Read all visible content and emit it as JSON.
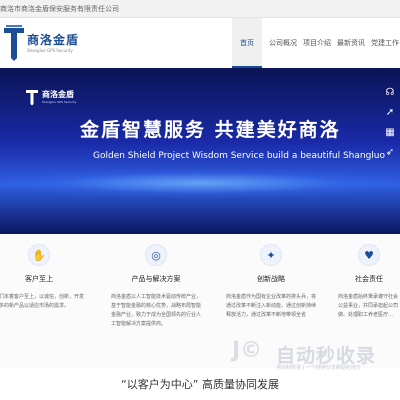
{
  "topbar": {
    "company_full": "商洛市商洛金盾保安服务有限责任公司"
  },
  "header": {
    "logo_name": "商洛金盾",
    "logo_sub": "Shangluo GPS Security"
  },
  "nav": [
    {
      "label": "首页",
      "active": true
    },
    {
      "label": "公司概况",
      "active": false
    },
    {
      "label": "项目介绍",
      "active": false
    },
    {
      "label": "最新资讯",
      "active": false
    },
    {
      "label": "党建工作",
      "active": false
    }
  ],
  "banner": {
    "logo_name": "商洛金盾",
    "logo_sub": "Shangluo GPS Security",
    "title": "金盾智慧服务   共建美好商洛",
    "subtitle": "Golden Shield Project Wisdom Service   build a beautiful Shangluo"
  },
  "side_tools": [
    {
      "icon": "headset-icon",
      "glyph": "☊"
    },
    {
      "icon": "share-icon",
      "glyph": "➚"
    },
    {
      "icon": "qrcode-icon",
      "glyph": "▦"
    },
    {
      "icon": "rocket-icon",
      "glyph": "➶"
    }
  ],
  "features": [
    {
      "title": "客户至上",
      "desc": "我们本着客户至上，以诚信，创新，开发更多的新产品以适应市场的需求。",
      "icon": "handshake-icon",
      "glyph": "✋"
    },
    {
      "title": "产品与解决方案",
      "desc": "商洛金盾以人工智能技术驱动传统产业，基于智能金融的核心优势，战略布局智能金融产业，致力于成为全国领先的行业人工智能解决方案提供商。",
      "icon": "product-icon",
      "glyph": "◎"
    },
    {
      "title": "创新战略",
      "desc": "商洛金盾作为国有企业改革的排头兵，将通过改革不断注入新动能，通过创新持续释放活力，通过改革不断地带领全省",
      "icon": "bulb-icon",
      "glyph": "✦"
    },
    {
      "title": "社会责任",
      "desc": "商洛金盾始终秉承遵守社会公益事业，共同承担起公司做、处理职工养老医疗…",
      "icon": "heart-icon",
      "glyph": "♥"
    }
  ],
  "watermark": {
    "logo": "J©",
    "text": "自动秒收录",
    "sub": "自动秒收录 | 一个持续分享网站的地方"
  },
  "slogan": "“以客户为中心”  高质量协同发展",
  "colors": {
    "brand": "#1b4e96",
    "banner_dark": "#0a1455",
    "banner_light": "#2f5fe0"
  }
}
